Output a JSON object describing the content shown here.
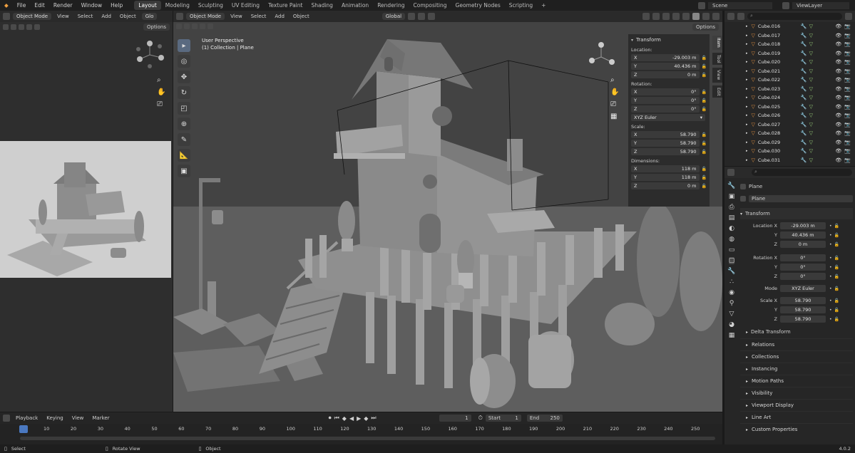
{
  "menu": [
    "File",
    "Edit",
    "Render",
    "Window",
    "Help"
  ],
  "workspaces": [
    "Layout",
    "Modeling",
    "Sculpting",
    "UV Editing",
    "Texture Paint",
    "Shading",
    "Animation",
    "Rendering",
    "Compositing",
    "Geometry Nodes",
    "Scripting"
  ],
  "active_workspace": "Layout",
  "scene": "Scene",
  "view_layer": "ViewLayer",
  "left_view": {
    "mode": "Object Mode",
    "menus": [
      "View",
      "Select",
      "Add",
      "Object"
    ],
    "glo": "Glo",
    "options": "Options"
  },
  "viewport": {
    "mode": "Object Mode",
    "menus": [
      "View",
      "Select",
      "Add",
      "Object"
    ],
    "orientation": "Global",
    "options": "Options",
    "overlay_title": "User Perspective",
    "overlay_sub": "(1) Collection | Plane",
    "side_tabs": [
      "Item",
      "Tool",
      "View",
      "Edit"
    ]
  },
  "npanel": {
    "title": "Transform",
    "location_label": "Location:",
    "location": [
      {
        "axis": "X",
        "value": "-29.003 m"
      },
      {
        "axis": "Y",
        "value": "40.436 m"
      },
      {
        "axis": "Z",
        "value": "0 m"
      }
    ],
    "rotation_label": "Rotation:",
    "rotation": [
      {
        "axis": "X",
        "value": "0°"
      },
      {
        "axis": "Y",
        "value": "0°"
      },
      {
        "axis": "Z",
        "value": "0°"
      }
    ],
    "rotation_mode": "XYZ Euler",
    "scale_label": "Scale:",
    "scale": [
      {
        "axis": "X",
        "value": "58.790"
      },
      {
        "axis": "Y",
        "value": "58.790"
      },
      {
        "axis": "Z",
        "value": "58.790"
      }
    ],
    "dimensions_label": "Dimensions:",
    "dimensions": [
      {
        "axis": "X",
        "value": "118 m"
      },
      {
        "axis": "Y",
        "value": "118 m"
      },
      {
        "axis": "Z",
        "value": "0 m"
      }
    ]
  },
  "outliner": [
    "Cube.016",
    "Cube.017",
    "Cube.018",
    "Cube.019",
    "Cube.020",
    "Cube.021",
    "Cube.022",
    "Cube.023",
    "Cube.024",
    "Cube.025",
    "Cube.026",
    "Cube.027",
    "Cube.028",
    "Cube.029",
    "Cube.030",
    "Cube.031"
  ],
  "properties": {
    "object_name": "Plane",
    "data_name": "Plane",
    "transform_title": "Transform",
    "location_x_label": "Location X",
    "location": [
      "-29.003 m",
      "40.436 m",
      "0 m"
    ],
    "rotation_x_label": "Rotation X",
    "rotation": [
      "0°",
      "0°",
      "0°"
    ],
    "mode_label": "Mode",
    "mode": "XYZ Euler",
    "scale_x_label": "Scale X",
    "scale": [
      "58.790",
      "58.790",
      "58.790"
    ],
    "y_label": "Y",
    "z_label": "Z",
    "delta": "Delta Transform",
    "sections": [
      "Relations",
      "Collections",
      "Instancing",
      "Motion Paths",
      "Visibility",
      "Viewport Display",
      "Line Art",
      "Custom Properties"
    ]
  },
  "timeline": {
    "menus": [
      "Playback",
      "Keying",
      "View",
      "Marker"
    ],
    "current_frame": "1",
    "start_label": "Start",
    "start": "1",
    "end_label": "End",
    "end": "250",
    "ticks": [
      "1",
      "10",
      "20",
      "30",
      "40",
      "50",
      "60",
      "70",
      "80",
      "90",
      "100",
      "110",
      "120",
      "130",
      "140",
      "150",
      "160",
      "170",
      "180",
      "190",
      "200",
      "210",
      "220",
      "230",
      "240",
      "250"
    ]
  },
  "status": {
    "select": "Select",
    "rotate": "Rotate View",
    "object": "Object",
    "version": "4.0.2"
  }
}
